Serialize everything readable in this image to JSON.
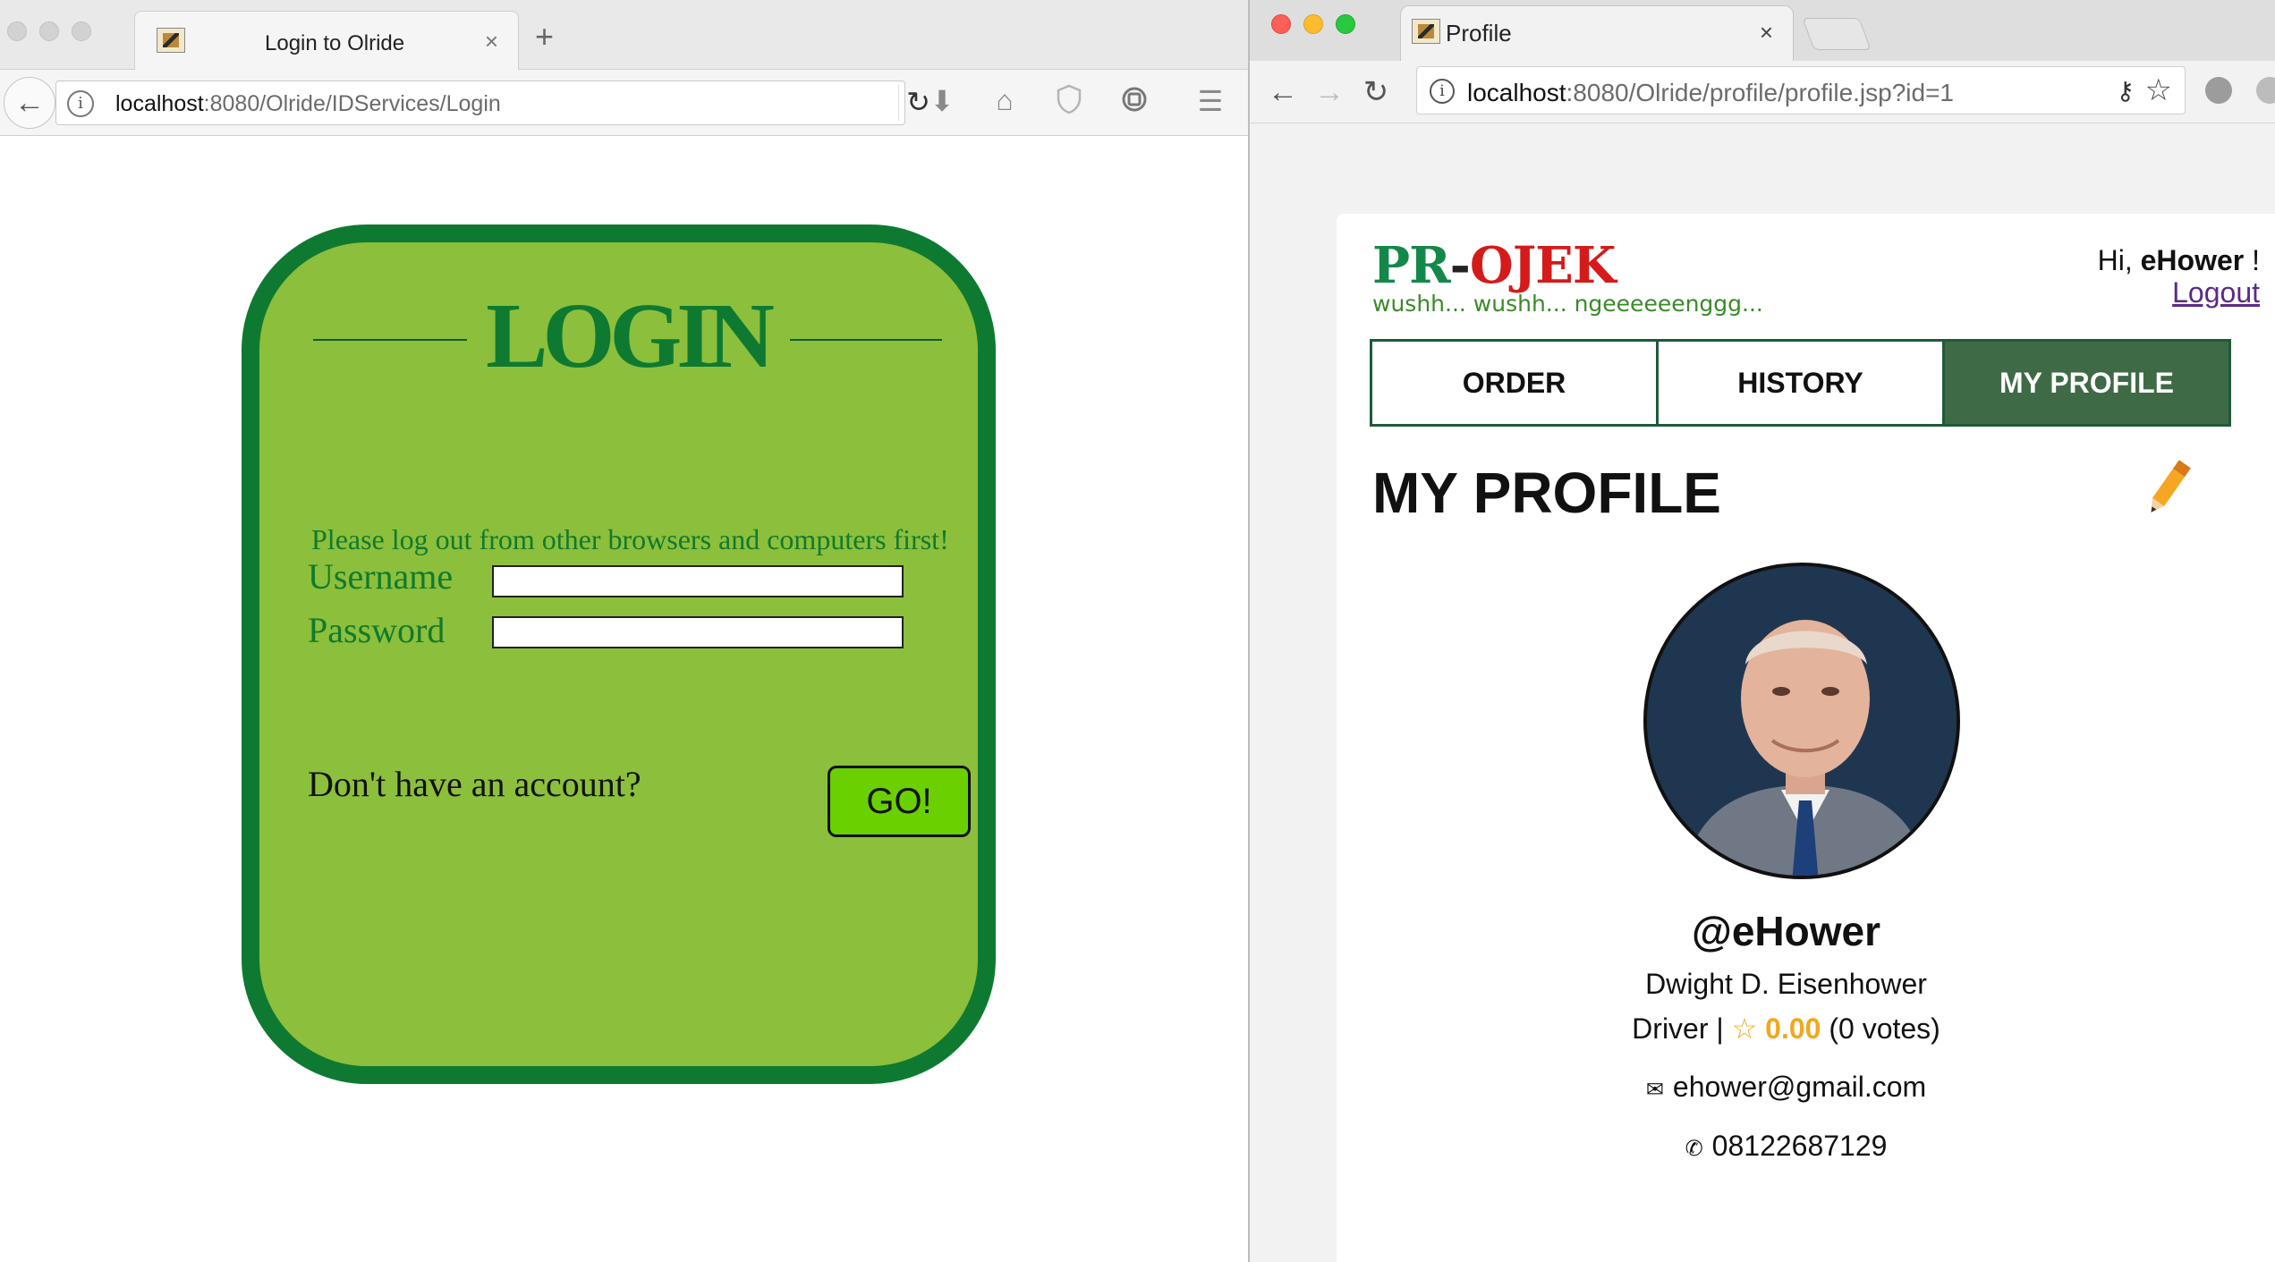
{
  "left_window": {
    "tab_title": "Login to Olride",
    "tab_close": "×",
    "new_tab": "+",
    "url_host": "localhost",
    "url_rest": ":8080/Olride/IDServices/Login",
    "login": {
      "title": "LOGIN",
      "notice": "Please log out from other browsers and computers first!",
      "username_label": "Username",
      "password_label": "Password",
      "username_value": "",
      "password_value": "",
      "no_account_text": "Don't have an account?",
      "go_button": "GO!"
    },
    "colors": {
      "card_fill": "#8cbf3b",
      "card_border": "#0e7a31",
      "go_button": "#6ad000"
    }
  },
  "right_window": {
    "tab_title": "Profile",
    "tab_close": "×",
    "url_host": "localhost",
    "url_rest": ":8080/Olride/profile/profile.jsp?id=1",
    "brand": {
      "pr": "PR",
      "dash": "-",
      "ojek": "OJEK",
      "tagline": "wushh... wushh... ngeeeeeenggg..."
    },
    "greeting": {
      "hi": "Hi, ",
      "user": "eHower",
      "suffix": " !"
    },
    "logout": "Logout",
    "nav": [
      "ORDER",
      "HISTORY",
      "MY PROFILE"
    ],
    "page_title": "MY PROFILE",
    "profile": {
      "username": "@eHower",
      "full_name": "Dwight D. Eisenhower",
      "role": "Driver",
      "role_sep": " | ",
      "rating": "0.00",
      "votes": "(0 votes)",
      "email": "ehower@gmail.com",
      "phone": "08122687129"
    },
    "colors": {
      "active_tab": "#3e6a46",
      "rating": "#f0a81d",
      "brand_pr": "#14884a",
      "brand_ojek": "#d51a1a"
    }
  }
}
